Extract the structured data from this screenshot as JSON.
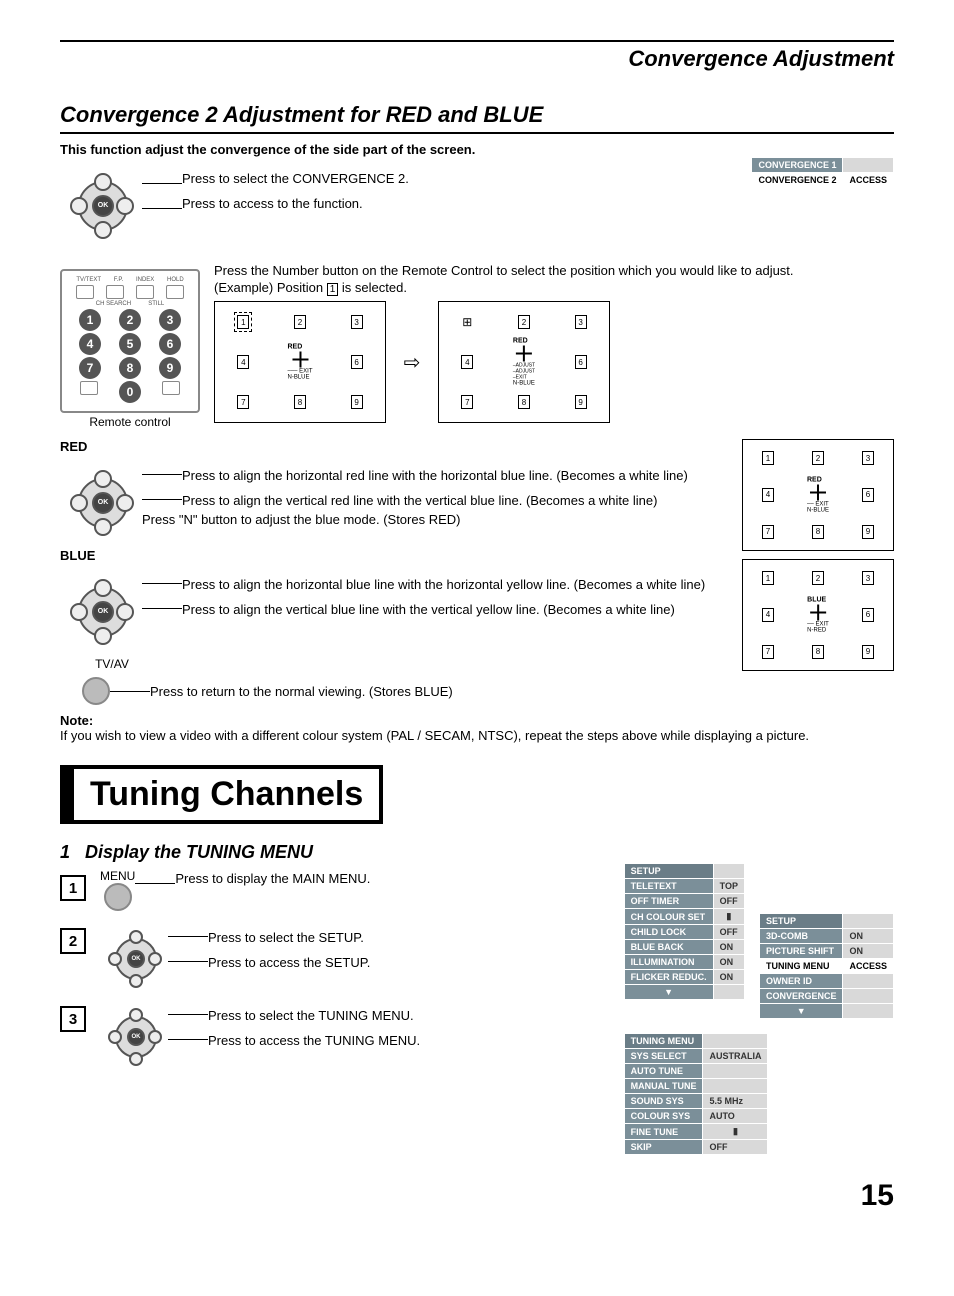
{
  "header": {
    "title": "Convergence Adjustment"
  },
  "sec1": {
    "title": "Convergence 2 Adjustment for RED and BLUE",
    "intro": "This function adjust the convergence of the side part of the screen.",
    "step_a": "Press to select the CONVERGENCE 2.",
    "step_b": "Press to access to the function.",
    "conv_menu": {
      "row1": "CONVERGENCE 1",
      "row2_label": "CONVERGENCE 2",
      "row2_val": "ACCESS"
    },
    "remote_instr1": "Press the Number button on the Remote Control to select the position which you would like to adjust.",
    "remote_instr2_pre": "(Example) Position",
    "remote_instr2_post": " is selected.",
    "example_num": "1",
    "remote_caption": "Remote control",
    "grid_labels": {
      "red": "RED",
      "blue": "BLUE",
      "nblue": "N-BLUE",
      "nred": "N-RED",
      "exit": "EXIT",
      "adjust": "ADJUST"
    },
    "red_heading": "RED",
    "red1": "Press to align the horizontal red line with the horizontal blue line. (Becomes a white line)",
    "red2": "Press to align the vertical red line with the vertical blue line. (Becomes a white line)",
    "red3": "Press \"N\" button to adjust the blue mode. (Stores RED)",
    "blue_heading": "BLUE",
    "blue1": "Press to align the horizontal blue line with the horizontal yellow line. (Becomes a white line)",
    "blue2": "Press to align the vertical blue line with the vertical yellow line. (Becomes a white line)",
    "tvav": "TV/AV",
    "tvav_instr": "Press to return to the normal viewing. (Stores BLUE)",
    "note_label": "Note:",
    "note_text": "If you wish to view a video with a different colour system (PAL / SECAM, NTSC), repeat the steps above while displaying a picture."
  },
  "sec2": {
    "title": "Tuning Channels",
    "step_title": "Display the TUNING MENU",
    "step_num": "1",
    "menu_label": "MENU",
    "s1": "Press to display the MAIN MENU.",
    "s2a": "Press to select the SETUP.",
    "s2b": "Press to access the SETUP.",
    "s3a": "Press to select the TUNING MENU.",
    "s3b": "Press to access the TUNING MENU.",
    "setup_menu": {
      "header": "SETUP",
      "rows": [
        [
          "TELETEXT",
          "TOP"
        ],
        [
          "OFF TIMER",
          "OFF"
        ],
        [
          "CH COLOUR SET",
          ""
        ],
        [
          "CHILD LOCK",
          "OFF"
        ],
        [
          "BLUE BACK",
          "ON"
        ],
        [
          "ILLUMINATION",
          "ON"
        ],
        [
          "FLICKER REDUC.",
          "ON"
        ]
      ],
      "arrow": "▼"
    },
    "setup_menu2": {
      "header": "SETUP",
      "rows": [
        [
          "3D-COMB",
          "ON"
        ],
        [
          "PICTURE SHIFT",
          "ON"
        ],
        [
          "TUNING MENU",
          "ACCESS"
        ],
        [
          "OWNER ID",
          ""
        ],
        [
          "CONVERGENCE",
          ""
        ]
      ],
      "arrow": "▼"
    },
    "tuning_menu": {
      "header": "TUNING MENU",
      "rows": [
        [
          "SYS SELECT",
          "AUSTRALIA"
        ],
        [
          "AUTO TUNE",
          ""
        ],
        [
          "MANUAL TUNE",
          ""
        ],
        [
          "SOUND  SYS",
          "5.5 MHz"
        ],
        [
          "COLOUR  SYS",
          "AUTO"
        ],
        [
          "FINE  TUNE",
          ""
        ],
        [
          "SKIP",
          "OFF"
        ]
      ]
    }
  },
  "page_number": "15",
  "remote_top_labels": [
    "TV/TEXT",
    "F.P.",
    "INDEX",
    "HOLD"
  ],
  "remote_sub_labels": [
    "",
    "CH SEARCH",
    "STILL",
    ""
  ]
}
